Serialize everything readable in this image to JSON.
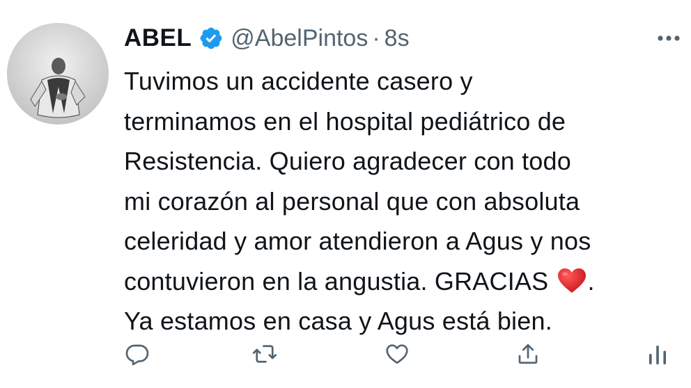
{
  "author": {
    "display_name": "ABEL",
    "handle": "@AbelPintos",
    "separator": "·",
    "timestamp": "8s",
    "verified": true
  },
  "tweet": {
    "lines": [
      "Tuvimos un accidente casero y",
      "terminamos en el hospital pediátrico de",
      "Resistencia. Quiero agradecer con todo",
      "mi corazón al personal que con absoluta",
      "celeridad y amor atendieron a Agus y nos",
      "contuvieron en la angustia. GRACIAS",
      "Ya estamos en casa y Agus está bien."
    ],
    "line6_suffix": ".",
    "emoji": "red-heart"
  },
  "actions": [
    {
      "icon": "reply-icon"
    },
    {
      "icon": "retweet-icon"
    },
    {
      "icon": "like-icon"
    },
    {
      "icon": "share-icon"
    },
    {
      "icon": "analytics-icon"
    }
  ],
  "colors": {
    "text": "#0f1419",
    "secondary": "#536471",
    "verified": "#1d9bf0",
    "heart": "#d8232a"
  }
}
